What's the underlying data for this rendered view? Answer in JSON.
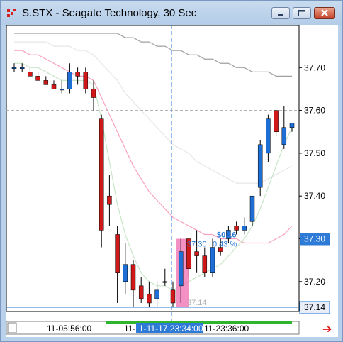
{
  "window": {
    "title": "S.STX - Seagate Technology, 30 Sec",
    "buttons": [
      "minimize",
      "maximize",
      "close"
    ]
  },
  "chart_data": {
    "type": "candlestick",
    "price_axis": {
      "ticks": [
        "37.70",
        "37.60",
        "37.50",
        "37.40",
        "37.30",
        "37.20"
      ],
      "tick_values": [
        37.7,
        37.6,
        37.5,
        37.4,
        37.3,
        37.2
      ],
      "ylim": [
        37.13,
        37.8
      ],
      "current_price_label": "37.30",
      "current_price": 37.3,
      "low_price_label": "37.14",
      "low_price": 37.14,
      "crosshair_price": 37.6
    },
    "time_axis": {
      "labels": [
        "11-05:56:00",
        "11-",
        "1-11-17 23:34:00",
        "11-23:36:00"
      ],
      "highlight_label": "1-11-17 23:34:00"
    },
    "measure": {
      "change": "$0.16",
      "percent": "0.43 %",
      "from_price": "37.30",
      "base_price": "37.14"
    },
    "candles": [
      {
        "o": 37.7,
        "h": 37.71,
        "l": 37.69,
        "c": 37.7
      },
      {
        "o": 37.7,
        "h": 37.71,
        "l": 37.69,
        "c": 37.7
      },
      {
        "o": 37.69,
        "h": 37.7,
        "l": 37.68,
        "c": 37.68
      },
      {
        "o": 37.68,
        "h": 37.69,
        "l": 37.67,
        "c": 37.67
      },
      {
        "o": 37.67,
        "h": 37.68,
        "l": 37.66,
        "c": 37.66
      },
      {
        "o": 37.66,
        "h": 37.67,
        "l": 37.65,
        "c": 37.65
      },
      {
        "o": 37.65,
        "h": 37.67,
        "l": 37.64,
        "c": 37.65
      },
      {
        "o": 37.65,
        "h": 37.71,
        "l": 37.64,
        "c": 37.69
      },
      {
        "o": 37.69,
        "h": 37.7,
        "l": 37.66,
        "c": 37.68
      },
      {
        "o": 37.69,
        "h": 37.7,
        "l": 37.64,
        "c": 37.65
      },
      {
        "o": 37.65,
        "h": 37.67,
        "l": 37.6,
        "c": 37.63
      },
      {
        "o": 37.58,
        "h": 37.59,
        "l": 37.28,
        "c": 37.32
      },
      {
        "o": 37.4,
        "h": 37.45,
        "l": 37.33,
        "c": 37.38
      },
      {
        "o": 37.31,
        "h": 37.33,
        "l": 37.15,
        "c": 37.22
      },
      {
        "o": 37.2,
        "h": 37.29,
        "l": 37.17,
        "c": 37.24
      },
      {
        "o": 37.24,
        "h": 37.25,
        "l": 37.14,
        "c": 37.18
      },
      {
        "o": 37.19,
        "h": 37.21,
        "l": 37.15,
        "c": 37.16
      },
      {
        "o": 37.17,
        "h": 37.2,
        "l": 37.14,
        "c": 37.15
      },
      {
        "o": 37.16,
        "h": 37.2,
        "l": 37.14,
        "c": 37.18
      },
      {
        "o": 37.2,
        "h": 37.23,
        "l": 37.19,
        "c": 37.2
      },
      {
        "o": 37.18,
        "h": 37.2,
        "l": 37.14,
        "c": 37.15
      },
      {
        "o": 37.19,
        "h": 37.3,
        "l": 37.15,
        "c": 37.27
      },
      {
        "o": 37.3,
        "h": 37.3,
        "l": 37.21,
        "c": 37.23
      },
      {
        "o": 37.27,
        "h": 37.32,
        "l": 37.22,
        "c": 37.26
      },
      {
        "o": 37.26,
        "h": 37.28,
        "l": 37.21,
        "c": 37.22
      },
      {
        "o": 37.22,
        "h": 37.3,
        "l": 37.21,
        "c": 37.28
      },
      {
        "o": 37.28,
        "h": 37.3,
        "l": 37.26,
        "c": 37.27
      },
      {
        "o": 37.3,
        "h": 37.33,
        "l": 37.29,
        "c": 37.32
      },
      {
        "o": 37.33,
        "h": 37.34,
        "l": 37.31,
        "c": 37.32
      },
      {
        "o": 37.32,
        "h": 37.35,
        "l": 37.31,
        "c": 37.33
      },
      {
        "o": 37.34,
        "h": 37.4,
        "l": 37.33,
        "c": 37.4
      },
      {
        "o": 37.42,
        "h": 37.53,
        "l": 37.4,
        "c": 37.52
      },
      {
        "o": 37.5,
        "h": 37.59,
        "l": 37.48,
        "c": 37.58
      },
      {
        "o": 37.6,
        "h": 37.6,
        "l": 37.54,
        "c": 37.55
      },
      {
        "o": 37.52,
        "h": 37.61,
        "l": 37.51,
        "c": 37.56
      },
      {
        "o": 37.56,
        "h": 37.57,
        "l": 37.55,
        "c": 37.57
      }
    ],
    "overlays": [
      {
        "color": "#a0a0a0",
        "values": [
          37.78,
          37.78,
          37.78,
          37.78,
          37.78,
          37.78,
          37.78,
          37.78,
          37.78,
          37.78,
          37.78,
          37.78,
          37.78,
          37.78,
          37.77,
          37.77,
          37.76,
          37.76,
          37.75,
          37.75,
          37.74,
          37.74,
          37.73,
          37.73,
          37.72,
          37.72,
          37.71,
          37.71,
          37.7,
          37.7,
          37.69,
          37.69,
          37.69,
          37.68,
          37.68,
          37.68
        ]
      },
      {
        "color": "#e6e6e6",
        "values": [
          37.76,
          37.76,
          37.76,
          37.76,
          37.76,
          37.75,
          37.75,
          37.75,
          37.74,
          37.74,
          37.73,
          37.71,
          37.69,
          37.67,
          37.64,
          37.62,
          37.6,
          37.58,
          37.56,
          37.54,
          37.52,
          37.51,
          37.5,
          37.48,
          37.47,
          37.46,
          37.45,
          37.44,
          37.43,
          37.43,
          37.43,
          37.43,
          37.44,
          37.45,
          37.46,
          37.47
        ]
      },
      {
        "color": "#f8a0c0",
        "values": [
          37.74,
          37.74,
          37.73,
          37.73,
          37.72,
          37.71,
          37.7,
          37.69,
          37.68,
          37.68,
          37.67,
          37.63,
          37.59,
          37.55,
          37.51,
          37.47,
          37.44,
          37.41,
          37.39,
          37.37,
          37.35,
          37.34,
          37.33,
          37.32,
          37.31,
          37.31,
          37.3,
          37.3,
          37.3,
          37.29,
          37.29,
          37.29,
          37.29,
          37.3,
          37.31,
          37.33
        ]
      },
      {
        "color": "#c8e6c8",
        "values": [
          37.71,
          37.71,
          37.7,
          37.7,
          37.69,
          37.68,
          37.67,
          37.67,
          37.67,
          37.67,
          37.66,
          37.58,
          37.48,
          37.38,
          37.31,
          37.26,
          37.22,
          37.2,
          37.19,
          37.19,
          37.18,
          37.19,
          37.2,
          37.21,
          37.22,
          37.23,
          37.24,
          37.26,
          37.28,
          37.3,
          37.33,
          37.37,
          37.42,
          37.47,
          37.52,
          37.56
        ]
      }
    ]
  }
}
